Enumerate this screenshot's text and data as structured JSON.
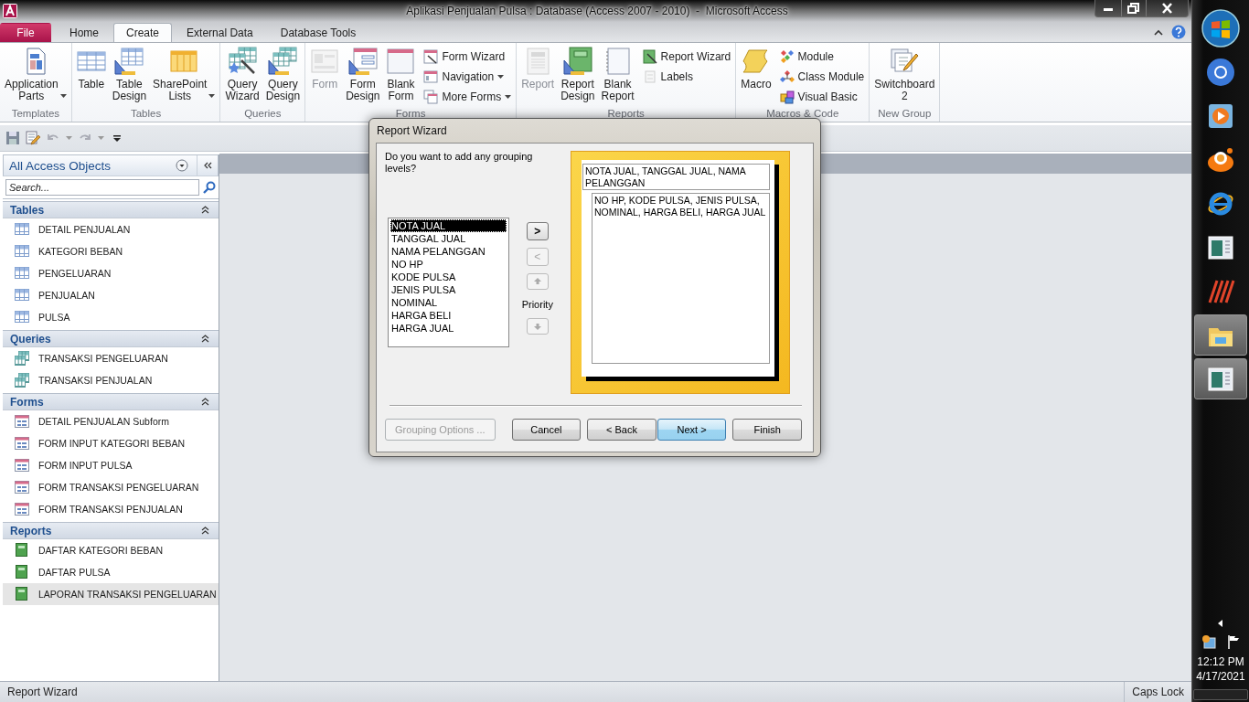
{
  "window": {
    "title": "Aplikasi Penjualan Pulsa : Database (Access 2007 - 2010)  -  Microsoft Access"
  },
  "ribbon_tabs": [
    {
      "label": "File",
      "kind": "file",
      "selected": false
    },
    {
      "label": "Home",
      "kind": "tab",
      "selected": false
    },
    {
      "label": "Create",
      "kind": "tab",
      "selected": true
    },
    {
      "label": "External Data",
      "kind": "tab",
      "selected": false
    },
    {
      "label": "Database Tools",
      "kind": "tab",
      "selected": false
    }
  ],
  "ribbon_groups": [
    {
      "label": "Templates",
      "buttons": [
        {
          "label": "Application Parts",
          "kind": "large",
          "dropdown": true,
          "disabled": false
        }
      ]
    },
    {
      "label": "Tables",
      "buttons": [
        {
          "label": "Table",
          "kind": "large",
          "dropdown": false,
          "disabled": false
        },
        {
          "label": "Table Design",
          "kind": "large",
          "dropdown": false,
          "disabled": false
        },
        {
          "label": "SharePoint Lists",
          "kind": "large",
          "dropdown": true,
          "disabled": false
        }
      ]
    },
    {
      "label": "Queries",
      "buttons": [
        {
          "label": "Query Wizard",
          "kind": "large",
          "dropdown": false,
          "disabled": false
        },
        {
          "label": "Query Design",
          "kind": "large",
          "dropdown": false,
          "disabled": false
        }
      ]
    },
    {
      "label": "Forms",
      "buttons": [
        {
          "label": "Form",
          "kind": "large",
          "dropdown": false,
          "disabled": true
        },
        {
          "label": "Form Design",
          "kind": "large",
          "dropdown": false,
          "disabled": false
        },
        {
          "label": "Blank Form",
          "kind": "large",
          "dropdown": false,
          "disabled": false
        },
        {
          "label": "Form Wizard",
          "kind": "small",
          "dropdown": false,
          "disabled": false
        },
        {
          "label": "Navigation",
          "kind": "small",
          "dropdown": true,
          "disabled": false
        },
        {
          "label": "More Forms",
          "kind": "small",
          "dropdown": true,
          "disabled": false
        }
      ]
    },
    {
      "label": "Reports",
      "buttons": [
        {
          "label": "Report",
          "kind": "large",
          "dropdown": false,
          "disabled": true
        },
        {
          "label": "Report Design",
          "kind": "large",
          "dropdown": false,
          "disabled": false
        },
        {
          "label": "Blank Report",
          "kind": "large",
          "dropdown": false,
          "disabled": false
        },
        {
          "label": "Report Wizard",
          "kind": "small",
          "dropdown": false,
          "disabled": false
        },
        {
          "label": "Labels",
          "kind": "small",
          "dropdown": false,
          "disabled": true
        }
      ]
    },
    {
      "label": "Macros & Code",
      "buttons": [
        {
          "label": "Macro",
          "kind": "large",
          "dropdown": false,
          "disabled": false
        },
        {
          "label": "Module",
          "kind": "small",
          "dropdown": false,
          "disabled": false
        },
        {
          "label": "Class Module",
          "kind": "small",
          "dropdown": false,
          "disabled": false
        },
        {
          "label": "Visual Basic",
          "kind": "small",
          "dropdown": false,
          "disabled": false
        }
      ]
    },
    {
      "label": "New Group",
      "buttons": [
        {
          "label": "Switchboard 2",
          "kind": "large",
          "dropdown": false,
          "disabled": false
        }
      ]
    }
  ],
  "quick_access": [
    {
      "disabled": false
    },
    {
      "disabled": false
    },
    {
      "disabled": true
    },
    {
      "disabled": true
    },
    {
      "disabled": false
    }
  ],
  "navigation_pane": {
    "title": "All Access Objects",
    "search": {
      "placeholder": "Search..."
    },
    "sections": [
      {
        "label": "Tables",
        "items": [
          {
            "label": "DETAIL PENJUALAN",
            "selected": false
          },
          {
            "label": "KATEGORI BEBAN",
            "selected": false
          },
          {
            "label": "PENGELUARAN",
            "selected": false
          },
          {
            "label": "PENJUALAN",
            "selected": false
          },
          {
            "label": "PULSA",
            "selected": false
          }
        ]
      },
      {
        "label": "Queries",
        "items": [
          {
            "label": "TRANSAKSI PENGELUARAN",
            "selected": false
          },
          {
            "label": "TRANSAKSI PENJUALAN",
            "selected": false
          }
        ]
      },
      {
        "label": "Forms",
        "items": [
          {
            "label": "DETAIL PENJUALAN Subform",
            "selected": false
          },
          {
            "label": "FORM INPUT KATEGORI BEBAN",
            "selected": false
          },
          {
            "label": "FORM INPUT PULSA",
            "selected": false
          },
          {
            "label": "FORM TRANSAKSI PENGELUARAN",
            "selected": false
          },
          {
            "label": "FORM TRANSAKSI PENJUALAN",
            "selected": false
          }
        ]
      },
      {
        "label": "Reports",
        "items": [
          {
            "label": "DAFTAR KATEGORI BEBAN",
            "selected": false
          },
          {
            "label": "DAFTAR PULSA",
            "selected": false
          },
          {
            "label": "LAPORAN TRANSAKSI PENGELUARAN",
            "selected": true
          }
        ]
      }
    ]
  },
  "report_wizard": {
    "title": "Report Wizard",
    "prompt": "Do you want to add any grouping levels?",
    "fields": [
      {
        "label": "NOTA JUAL",
        "selected": true
      },
      {
        "label": "TANGGAL JUAL",
        "selected": false
      },
      {
        "label": "NAMA PELANGGAN",
        "selected": false
      },
      {
        "label": "NO HP",
        "selected": false
      },
      {
        "label": "KODE PULSA",
        "selected": false
      },
      {
        "label": "JENIS PULSA",
        "selected": false
      },
      {
        "label": "NOMINAL",
        "selected": false
      },
      {
        "label": "HARGA BELI",
        "selected": false
      },
      {
        "label": "HARGA JUAL",
        "selected": false
      }
    ],
    "move_buttons": [
      {
        "label": ">",
        "disabled": false
      },
      {
        "label": "<",
        "disabled": true
      }
    ],
    "priority_label": "Priority",
    "priority_buttons": [
      {
        "kind": "up",
        "disabled": true
      },
      {
        "kind": "down",
        "disabled": true
      }
    ],
    "preview": {
      "group_header": "NOTA JUAL, TANGGAL JUAL, NAMA PELANGGAN",
      "detail": "NO HP, KODE PULSA, JENIS PULSA, NOMINAL, HARGA BELI, HARGA JUAL"
    },
    "buttons": [
      {
        "label": "Grouping Options ...",
        "disabled": true,
        "default": false
      },
      {
        "label": "Cancel",
        "disabled": false,
        "default": false
      },
      {
        "label": "< Back",
        "disabled": false,
        "default": false
      },
      {
        "label": "Next >",
        "disabled": false,
        "default": true
      },
      {
        "label": "Finish",
        "disabled": false,
        "default": false
      }
    ]
  },
  "status_bar": {
    "message": "Report Wizard",
    "indicator": "Caps Lock"
  },
  "taskbar": {
    "apps": [
      {
        "active": false
      },
      {
        "active": false
      },
      {
        "active": false
      },
      {
        "active": false
      },
      {
        "active": false
      },
      {
        "active": false
      },
      {
        "active": true
      },
      {
        "active": true
      }
    ],
    "time": "12:12 PM",
    "date": "4/17/2021"
  }
}
